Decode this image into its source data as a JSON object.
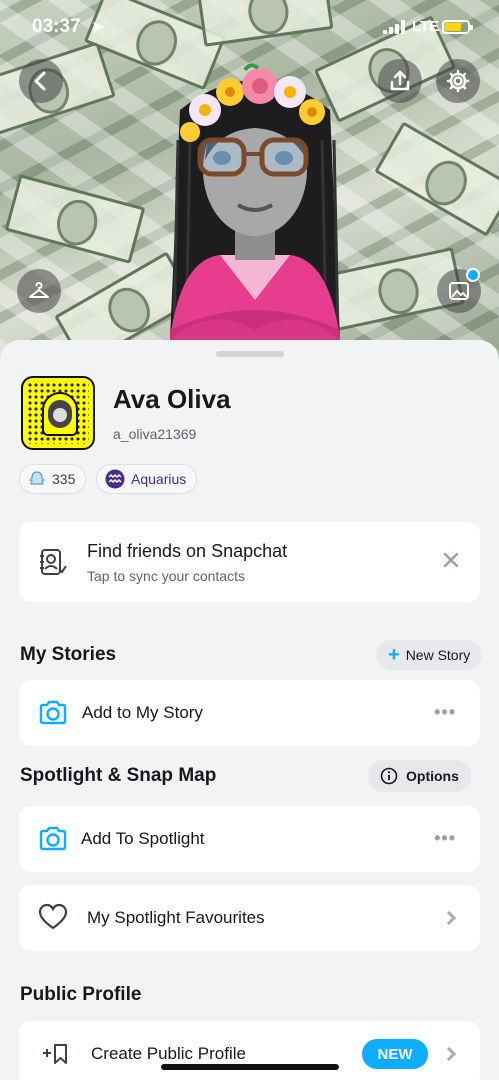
{
  "status_bar": {
    "time": "03:37",
    "network": "LTE",
    "battery_color": "#ffd400"
  },
  "header": {
    "icons": [
      "back-icon",
      "share-icon",
      "gear-icon",
      "hanger-icon",
      "photo-icon"
    ],
    "notification_dot_color": "#0fadff"
  },
  "profile": {
    "display_name": "Ava Oliva",
    "username": "a_oliva21369",
    "score": "335",
    "zodiac": "Aquarius"
  },
  "find_friends": {
    "title": "Find friends on Snapchat",
    "subtitle": "Tap to sync your contacts"
  },
  "my_stories": {
    "title": "My Stories",
    "new_story_label": "New Story",
    "add_story_label": "Add to My Story"
  },
  "spotlight": {
    "title": "Spotlight & Snap Map",
    "options_label": "Options",
    "add_label": "Add To Spotlight",
    "favourites_label": "My Spotlight Favourites"
  },
  "public_profile": {
    "title": "Public Profile",
    "create_label": "Create Public Profile",
    "badge": "NEW"
  },
  "colors": {
    "accent_blue": "#0fadff",
    "snap_yellow": "#fffc00",
    "zodiac_purple": "#4b2a8e"
  }
}
